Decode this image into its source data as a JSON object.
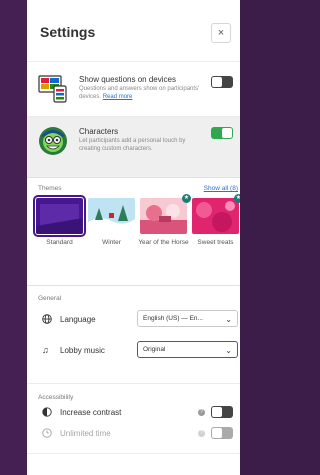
{
  "panel": {
    "title": "Settings",
    "close_icon": "close-icon",
    "close_label": "×"
  },
  "show_questions": {
    "title": "Show questions on devices",
    "desc": "Questions and answers show on participants' devices.",
    "link": "Read more",
    "toggle_on": false
  },
  "characters": {
    "title": "Characters",
    "desc": "Let participants add a personal touch by creating custom characters.",
    "toggle_on": true
  },
  "themes": {
    "label": "Themes",
    "show_all": "Show all (8)",
    "items": [
      {
        "name": "Standard",
        "selected": true,
        "badge": false
      },
      {
        "name": "Winter",
        "selected": false,
        "badge": false
      },
      {
        "name": "Year of the Horse",
        "selected": false,
        "badge": true
      },
      {
        "name": "Sweet treats",
        "selected": false,
        "badge": true
      }
    ]
  },
  "general": {
    "label": "General",
    "language": {
      "label": "Language",
      "icon": "globe-icon",
      "value": "English (US) — En..."
    },
    "lobby_music": {
      "label": "Lobby music",
      "icon": "music-note-icon",
      "value": "Original"
    }
  },
  "accessibility": {
    "label": "Accessibility",
    "contrast": {
      "label": "Increase contrast",
      "icon": "contrast-icon",
      "toggle_on": false
    },
    "time": {
      "label": "Unlimited time",
      "icon": "clock-icon",
      "toggle_on": false,
      "disabled": true
    }
  },
  "colors": {
    "accent": "#46178f",
    "toggle_on": "#2fa84f",
    "toggle_off": "#444444",
    "link": "#2f6fcf"
  }
}
